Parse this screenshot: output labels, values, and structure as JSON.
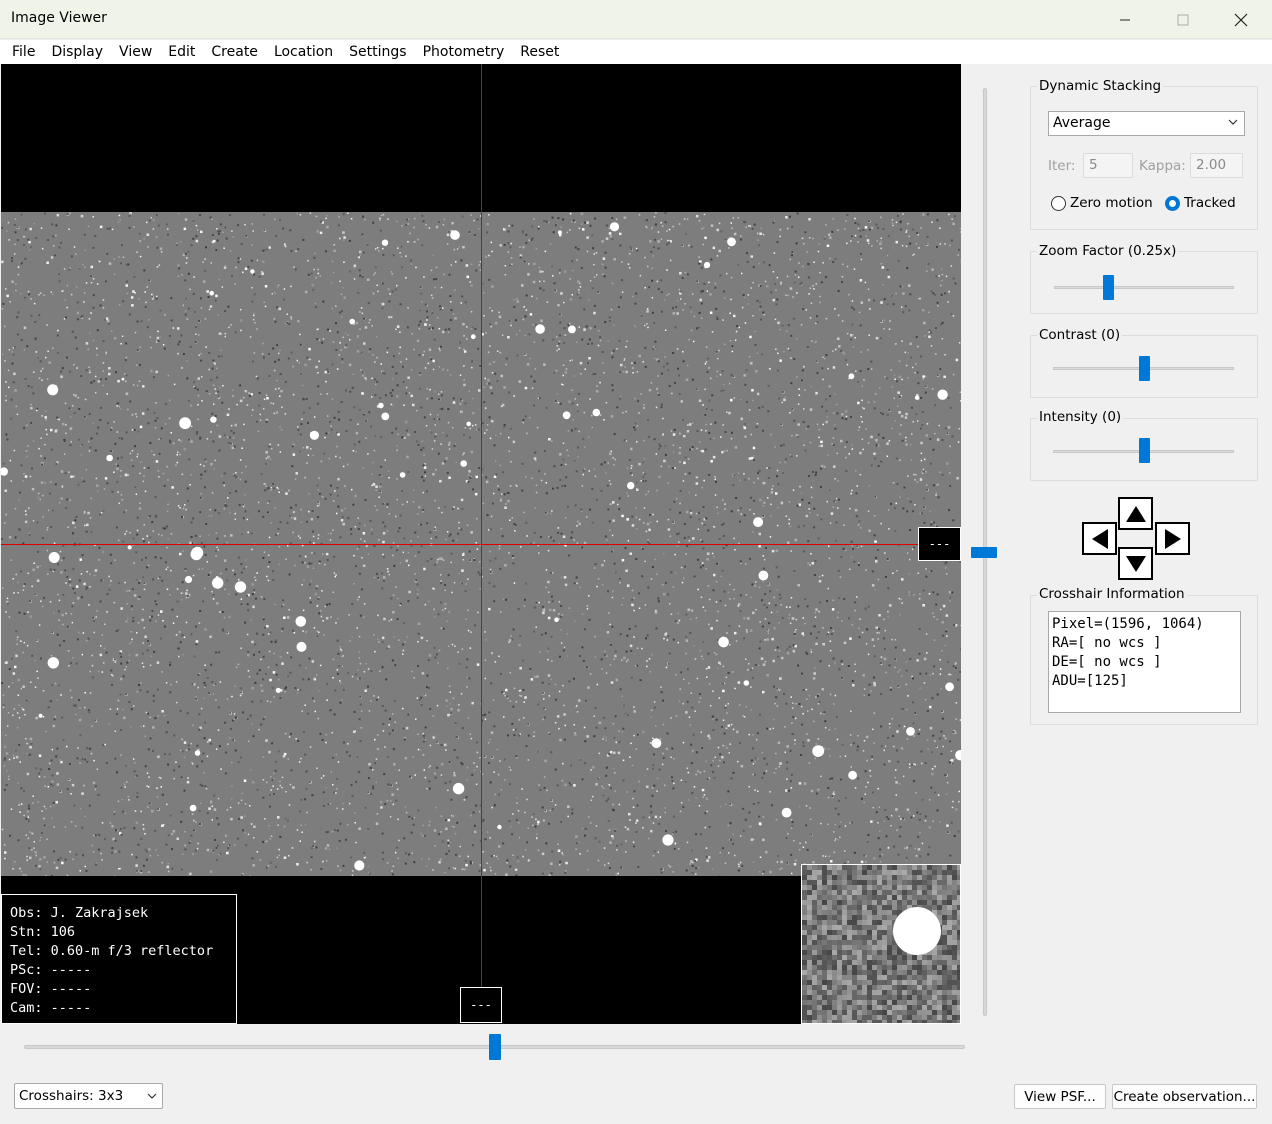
{
  "window": {
    "title": "Image Viewer",
    "minimize_icon": "minimize-icon",
    "maximize_icon": "maximize-icon",
    "close_icon": "close-icon"
  },
  "menu": [
    "File",
    "Display",
    "View",
    "Edit",
    "Create",
    "Location",
    "Settings",
    "Photometry",
    "Reset"
  ],
  "image": {
    "cross_box_right": "---",
    "cross_box_bottom": "---",
    "info_lines": [
      "Obs: J. Zakrajsek",
      "Stn: 106",
      "Tel: 0.60-m f/3 reflector",
      "PSc: -----",
      "FOV: -----",
      "Cam: -----"
    ],
    "crosshair_color": "#e00000"
  },
  "dynamic_stacking": {
    "label": "Dynamic Stacking",
    "mode": "Average",
    "iter_label": "Iter:",
    "iter_value": "5",
    "kappa_label": "Kappa:",
    "kappa_value": "2.00",
    "radio_zero_motion": "Zero motion",
    "radio_tracked": "Tracked",
    "selected": "Tracked"
  },
  "zoom": {
    "label": "Zoom Factor (0.25x)",
    "level": 0.3
  },
  "contrast": {
    "label": "Contrast (0)",
    "level": 0.5
  },
  "intensity": {
    "label": "Intensity (0)",
    "level": 0.5
  },
  "nav_arrows": [
    "arrow-up-icon",
    "arrow-left-icon",
    "arrow-right-icon",
    "arrow-down-icon"
  ],
  "crosshair_info": {
    "label": "Crosshair Information",
    "lines": [
      "Pixel=(1596, 1064)",
      "RA=[ no wcs ]",
      "DE=[ no wcs ]",
      "ADU=[125]"
    ]
  },
  "sliders": {
    "vertical_level": 0.5,
    "horizontal_level": 0.5
  },
  "bottom": {
    "crosshairs_select": "Crosshairs: 3x3",
    "view_psf": "View PSF...",
    "create_observation": "Create observation..."
  },
  "colors": {
    "accent": "#0078d7",
    "titlebar": "#f0f4e8"
  }
}
